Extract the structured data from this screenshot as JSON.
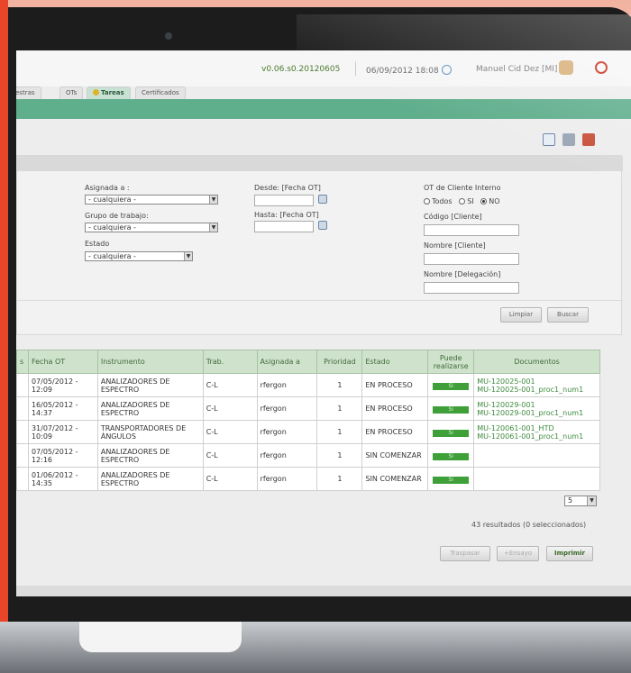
{
  "topbar": {
    "version": "v0.06.s0.20120605",
    "datetime": "06/09/2012 18:08",
    "user": "Manuel Cid Dez [MI]"
  },
  "tabs": [
    {
      "label": "estras"
    },
    {
      "label": "OTs"
    },
    {
      "label": "Tareas"
    },
    {
      "label": "Certificados"
    }
  ],
  "filters": {
    "asignada_label": "Asignada a :",
    "asignada_value": "- cualquiera -",
    "grupo_label": "Grupo de trabajo:",
    "grupo_value": "- cualquiera -",
    "estado_label": "Estado",
    "estado_value": "- cualquiera -",
    "desde_label": "Desde: [Fecha OT]",
    "hasta_label": "Hasta: [Fecha OT]",
    "ot_cliente_label": "OT de Cliente Interno",
    "radio_todos": "Todos",
    "radio_si": "SI",
    "radio_no": "NO",
    "codigo_label": "Código [Cliente]",
    "nombre_label": "Nombre [Cliente]",
    "delegacion_label": "Nombre [Delegación]",
    "limpiar": "Limpiar",
    "buscar": "Buscar"
  },
  "table": {
    "headers": [
      "s",
      "Fecha OT",
      "Instrumento",
      "Trab.",
      "Asignada a",
      "Prioridad",
      "Estado",
      "Puede realizarse",
      "Documentos"
    ],
    "rows": [
      {
        "fecha": "07/05/2012 - 12:09",
        "instrumento": "ANALIZADORES DE ESPECTRO",
        "trab": "C-L",
        "asignada": "rfergon",
        "prioridad": "1",
        "estado": "EN PROCESO",
        "puede": "Si",
        "doc1": "MU-120025-001",
        "doc2": "MU-120025-001_proc1_num1"
      },
      {
        "fecha": "16/05/2012 - 14:37",
        "instrumento": "ANALIZADORES DE ESPECTRO",
        "trab": "C-L",
        "asignada": "rfergon",
        "prioridad": "1",
        "estado": "EN PROCESO",
        "puede": "Si",
        "doc1": "MU-120029-001",
        "doc2": "MU-120029-001_proc1_num1"
      },
      {
        "fecha": "31/07/2012 - 10:09",
        "instrumento": "TRANSPORTADORES DE ÁNGULOS",
        "trab": "C-L",
        "asignada": "rfergon",
        "prioridad": "1",
        "estado": "EN PROCESO",
        "puede": "Si",
        "doc1": "MU-120061-001_HTD",
        "doc2": "MU-120061-001_proc1_num1"
      },
      {
        "fecha": "07/05/2012 - 12:16",
        "instrumento": "ANALIZADORES DE ESPECTRO",
        "trab": "C-L",
        "asignada": "rfergon",
        "prioridad": "1",
        "estado": "SIN COMENZAR",
        "puede": "Si",
        "doc1": "",
        "doc2": ""
      },
      {
        "fecha": "01/06/2012 - 14:35",
        "instrumento": "ANALIZADORES DE ESPECTRO",
        "trab": "C-L",
        "asignada": "rfergon",
        "prioridad": "1",
        "estado": "SIN COMENZAR",
        "puede": "Si",
        "doc1": "",
        "doc2": ""
      }
    ]
  },
  "pager": {
    "value": "5"
  },
  "results": "43 resultados (0 seleccionados)",
  "actions": {
    "traspasar": "Traspasar",
    "ensayo": "+Ensayo",
    "imprimir": "Imprimir"
  },
  "icons": [
    "clock-icon",
    "user-icon",
    "power-icon",
    "search-doc-icon",
    "print-icon",
    "home-icon",
    "calendar-icon",
    "dropdown-arrow-icon"
  ],
  "colors": {
    "accent_green": "#5fae8c",
    "table_header": "#cfe2cc",
    "si_green": "#3fa03a",
    "power_red": "#c8331e",
    "frame_orange": "#e8452a"
  }
}
